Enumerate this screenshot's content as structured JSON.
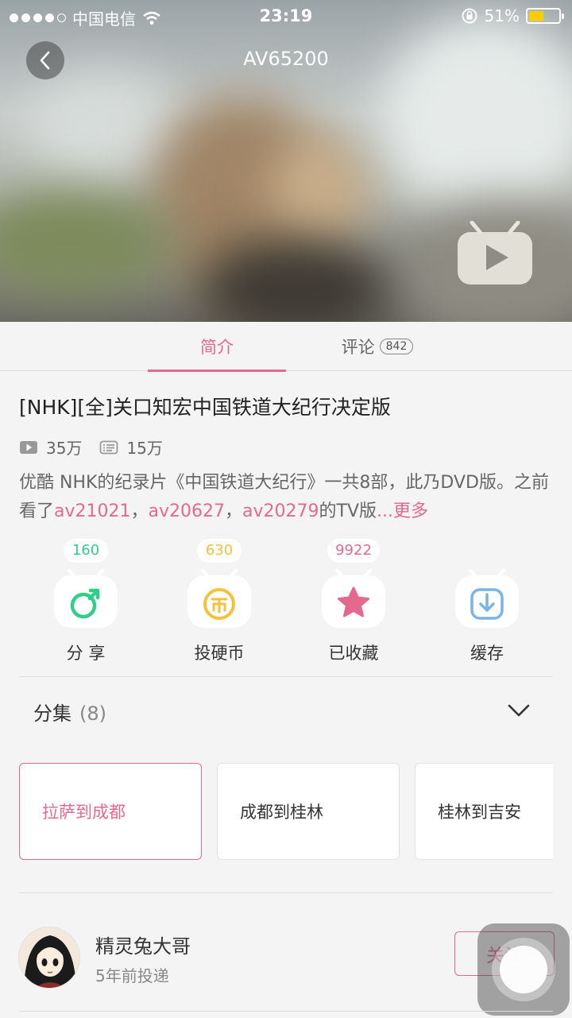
{
  "status_bar": {
    "carrier": "中国电信",
    "time": "23:19",
    "battery": "51%",
    "battery_level": 0.51
  },
  "header": {
    "title": "AV65200",
    "icons": [
      "back-icon",
      "tv-play-icon"
    ]
  },
  "tabs": {
    "intro": "简介",
    "comments": "评论",
    "comments_count": "842"
  },
  "video": {
    "title": "[NHK][全]关口知宏中国铁道大纪行决定版",
    "plays": "35万",
    "danmaku": "15万",
    "desc_prefix": "优酷 NHK的纪录片《中国铁道大纪行》一共8部，此乃DVD版。之前看了",
    "link1": "av21021",
    "sep1": "，",
    "link2": "av20627",
    "sep2": "，",
    "link3": "av20279",
    "desc_suffix": "的TV版",
    "more": "...更多"
  },
  "actions": {
    "share": {
      "count": "160",
      "label": "分 享",
      "color": "#2fcf8b"
    },
    "coin": {
      "count": "630",
      "label": "投硬币",
      "color": "#f5c13b"
    },
    "favorite": {
      "count": "9922",
      "label": "已收藏",
      "color": "#e4698f"
    },
    "cache": {
      "label": "缓存",
      "color": "#7ab3e6"
    }
  },
  "episodes": {
    "title": "分集",
    "count": "(8)",
    "items": [
      {
        "label": "拉萨到成都",
        "active": true
      },
      {
        "label": "成都到桂林",
        "active": false
      },
      {
        "label": "桂林到吉安",
        "active": false
      }
    ]
  },
  "uploader": {
    "name": "精灵兔大哥",
    "time": "5年前投递",
    "follow": "关注"
  },
  "colors": {
    "accent": "#e4698f",
    "background": "#f4f4f4"
  }
}
